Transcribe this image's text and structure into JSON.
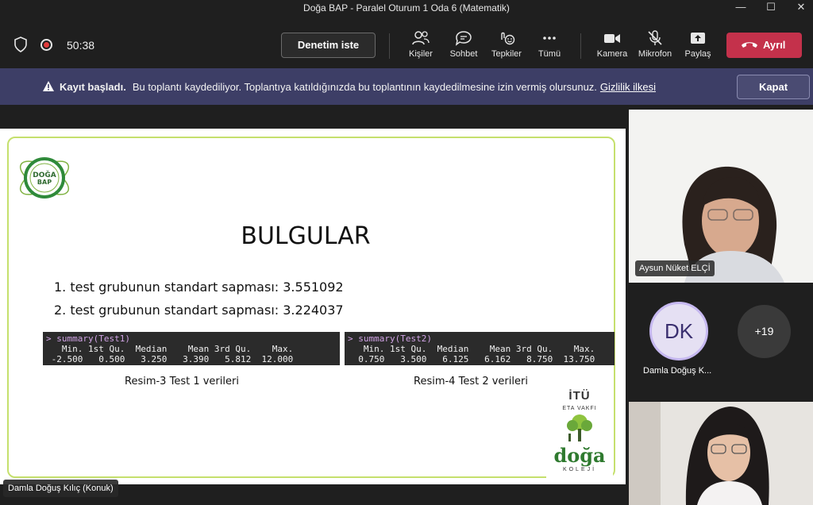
{
  "window": {
    "title": "Doğa BAP - Paralel Oturum 1 Oda 6 (Matematik)",
    "controls": [
      "—",
      "☐",
      "✕"
    ]
  },
  "toolbar": {
    "timer": "50:38",
    "request_control": "Denetim iste",
    "buttons": [
      {
        "label": "Kişiler",
        "icon": "people-icon"
      },
      {
        "label": "Sohbet",
        "icon": "chat-icon"
      },
      {
        "label": "Tepkiler",
        "icon": "reactions-icon"
      },
      {
        "label": "Tümü",
        "icon": "more-icon"
      },
      {
        "label": "Kamera",
        "icon": "camera-icon"
      },
      {
        "label": "Mikrofon",
        "icon": "mic-off-icon"
      },
      {
        "label": "Paylaş",
        "icon": "share-icon"
      }
    ],
    "leave": "Ayrıl",
    "colors": {
      "leave": "#c4314b",
      "record": "#e03b3b"
    }
  },
  "banner": {
    "bold": "Kayıt başladı.",
    "text": "Bu toplantı kaydediliyor. Toplantıya katıldığınızda bu toplantının kaydedilmesine izin vermiş olursunuz.",
    "link": "Gizlilik ilkesi",
    "close": "Kapat",
    "color": "#3d3e66"
  },
  "slide": {
    "logo_text": "DOĞA BAP",
    "title": "BULGULAR",
    "bullets": [
      "1. test grubunun standart sapması: 3.551092",
      "2. test grubunun standart sapması: 3.224037"
    ],
    "consoles": [
      {
        "cmd": "> summary(Test1)",
        "header": "   Min. 1st Qu.  Median    Mean 3rd Qu.    Max. ",
        "values": " -2.500   0.500   3.250   3.390   5.812  12.000 ",
        "caption": "Resim-3 Test 1 verileri"
      },
      {
        "cmd": "> summary(Test2)",
        "header": "   Min. 1st Qu.  Median    Mean 3rd Qu.    Max. ",
        "values": "  0.750   3.500   6.125   6.162   8.750  13.750 ",
        "caption": "Resim-4 Test 2 verileri"
      }
    ],
    "itu_logo": {
      "line1": "İTÜ",
      "line2": "ETA VAKFI",
      "line3": "doğa",
      "line4": "KOLEJİ"
    },
    "accent": "#c5e06d"
  },
  "presenter": "Damla Doğuş Kılıç (Konuk)",
  "participants": {
    "video1_name": "Aysun Nüket ELÇİ",
    "avatar_initials": "DK",
    "avatar_name": "Damla Doğuş K...",
    "more_count": "+19"
  }
}
